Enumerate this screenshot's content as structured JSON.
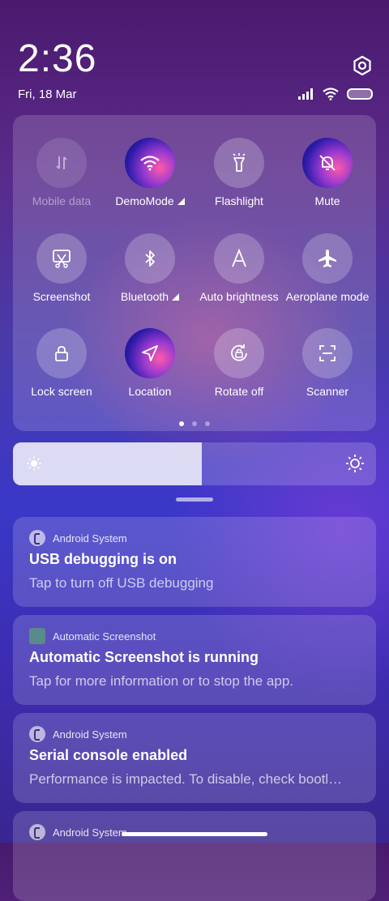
{
  "status": {
    "time": "2:36",
    "date": "Fri, 18 Mar"
  },
  "quick_settings": {
    "tiles": [
      {
        "label": "Mobile data",
        "icon": "mobile-data-icon",
        "state": "disabled"
      },
      {
        "label": "DemoMode",
        "icon": "wifi-icon",
        "state": "active"
      },
      {
        "label": "Flashlight",
        "icon": "flashlight-icon",
        "state": "off"
      },
      {
        "label": "Mute",
        "icon": "mute-bell-icon",
        "state": "active"
      },
      {
        "label": "Screenshot",
        "icon": "screenshot-icon",
        "state": "off"
      },
      {
        "label": "Bluetooth",
        "icon": "bluetooth-icon",
        "state": "off"
      },
      {
        "label": "Auto brightness",
        "icon": "auto-brightness-icon",
        "state": "off"
      },
      {
        "label": "Aeroplane mode",
        "icon": "aeroplane-icon",
        "state": "off"
      },
      {
        "label": "Lock screen",
        "icon": "lock-icon",
        "state": "off"
      },
      {
        "label": "Location",
        "icon": "location-icon",
        "state": "active"
      },
      {
        "label": "Rotate off",
        "icon": "rotate-icon",
        "state": "off"
      },
      {
        "label": "Scanner",
        "icon": "scanner-icon",
        "state": "off"
      }
    ],
    "page_count": 3,
    "current_page": 1
  },
  "brightness": {
    "level": 0.52
  },
  "notifications": [
    {
      "app": "Android System",
      "title": "USB debugging is on",
      "text": "Tap to turn off USB debugging"
    },
    {
      "app": "Automatic Screenshot",
      "title": "Automatic Screenshot is running",
      "text": "Tap for more information or to stop the app."
    },
    {
      "app": "Android System",
      "title": "Serial console enabled",
      "text": "Performance is impacted. To disable, check bootl…"
    },
    {
      "app": "Android System",
      "title": "",
      "text": ""
    }
  ]
}
